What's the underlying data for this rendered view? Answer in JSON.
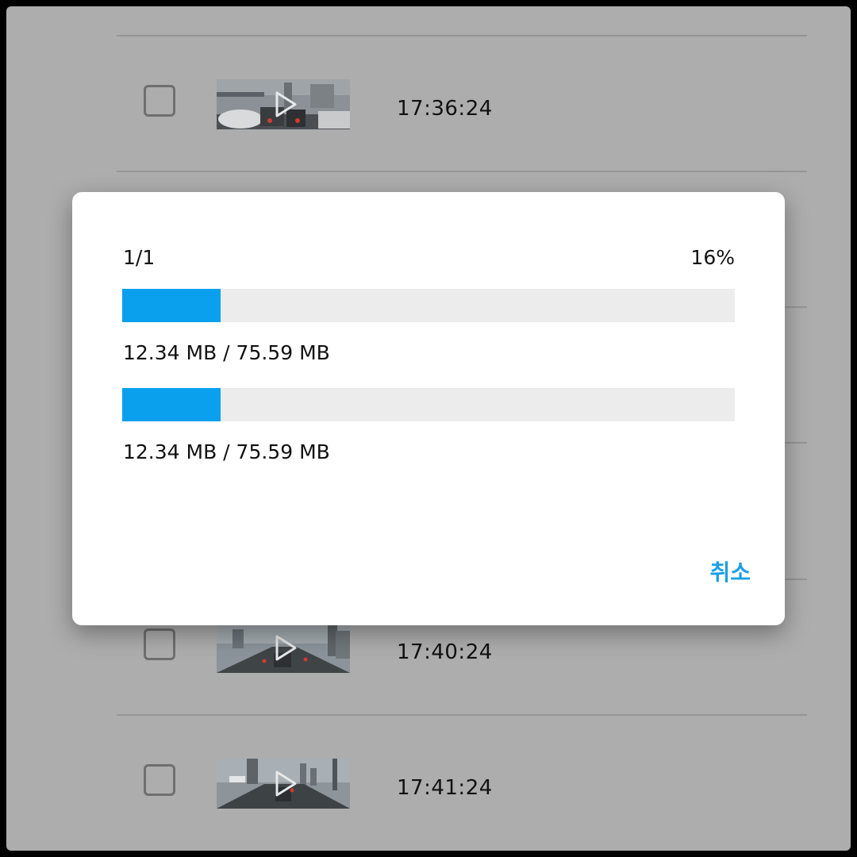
{
  "list": {
    "rows": [
      {
        "time": "17:36:24"
      },
      {
        "time": "17:40:24"
      },
      {
        "time": "17:41:24"
      }
    ]
  },
  "dialog": {
    "count": "1/1",
    "percent": "16%",
    "progress": 0.16,
    "bars": [
      {
        "progress": 0.16,
        "size_text": "12.34 MB / 75.59 MB"
      },
      {
        "progress": 0.16,
        "size_text": "12.34 MB / 75.59 MB"
      }
    ],
    "cancel_label": "취소"
  },
  "colors": {
    "accent": "#0aa0ee",
    "cancel": "#1c9fe6",
    "track": "#ececec",
    "backdrop": "#adadad"
  },
  "icons": {
    "thumbnail_overlay": "play-icon",
    "row_selector": "checkbox"
  }
}
